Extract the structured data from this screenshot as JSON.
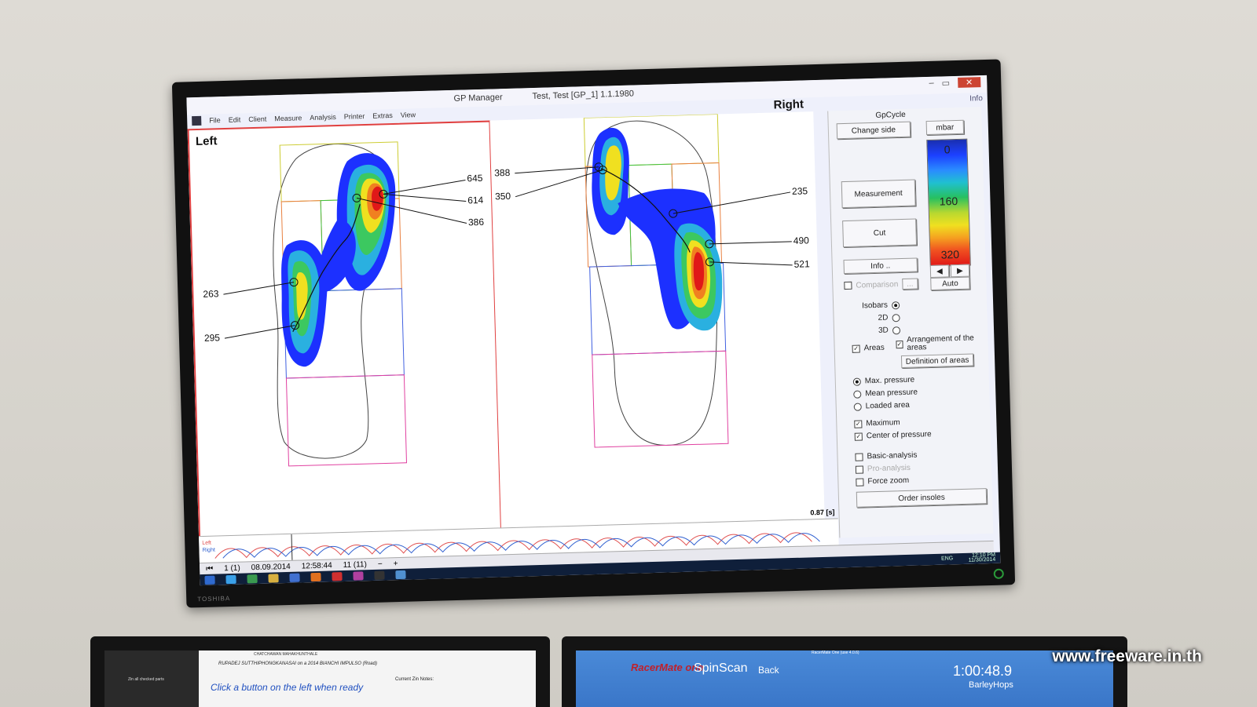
{
  "window": {
    "title": "GP Manager",
    "subtitle": "Test, Test   [GP_1]    1.1.1980",
    "controls": [
      "–",
      "▭",
      "✕"
    ],
    "info_link": "Info"
  },
  "menu": [
    "File",
    "Edit",
    "Client",
    "Measure",
    "Analysis",
    "Printer",
    "Extras",
    "View"
  ],
  "left_pane": {
    "label": "Left",
    "callouts": [
      "645",
      "614",
      "386",
      "263",
      "295"
    ]
  },
  "right_pane": {
    "label": "Right",
    "callouts": [
      "388",
      "350",
      "235",
      "490",
      "521"
    ]
  },
  "panel": {
    "header": "GpCycle",
    "buttons": {
      "change_side": "Change side",
      "measurement": "Measurement",
      "cut": "Cut",
      "info": "Info ..",
      "comparison": "Comparison",
      "comparison_more": "...",
      "order_insoles": "Order insoles",
      "definition_of_areas": "Definition of areas"
    },
    "scale": {
      "unit": "mbar",
      "ticks": [
        "0",
        "160",
        "320"
      ],
      "auto": "Auto",
      "arrows": [
        "◀",
        "▶"
      ]
    },
    "view": {
      "isobars": "Isobars",
      "two_d": "2D",
      "three_d": "3D"
    },
    "areas": "Areas",
    "arrangement": "Arrangement of the areas",
    "mode": {
      "max_pressure": "Max. pressure",
      "mean_pressure": "Mean pressure",
      "loaded_area": "Loaded area"
    },
    "checks": {
      "maximum": "Maximum",
      "center_of_pressure": "Center of pressure",
      "basic_analysis": "Basic-analysis",
      "pro_analysis": "Pro-analysis",
      "force_zoom": "Force zoom"
    }
  },
  "timeline": {
    "left": "Left",
    "right": "Right",
    "time": "0.87 [s]"
  },
  "status": {
    "page": "1 (1)",
    "date": "08.09.2014",
    "time": "12:58:44",
    "count": "11 (11)"
  },
  "taskbar": {
    "clock": "12:10 PM",
    "date": "11/30/2014",
    "lang": "ENG"
  },
  "tv_brand": "TOSHIBA",
  "bottom_left": {
    "title": "CHATCHAWAN MAHAKHUNTHALE",
    "athlete": "RUPADEJ SUTTHIPHONGKANASAI on a 2014 BIANCHI IMPULSO (Road)",
    "prompt": "Click a button on the left when ready",
    "notes": "Current Zin Notes:",
    "list_item": "Zin all checked parts"
  },
  "bottom_right": {
    "title": "RacerMate One (use 4.0.6)",
    "logo": "RacerMate one",
    "app": "SpinScan",
    "back": "Back",
    "timer": "1:00:48.9",
    "name": "BarleyHops"
  },
  "watermark": "www.freeware.in.th",
  "colors": {
    "frame_red": "#e04040",
    "scale_red": "#e01818",
    "scale_blue": "#1c40ff",
    "left_trace": "#e05050",
    "right_trace": "#3060d0"
  }
}
